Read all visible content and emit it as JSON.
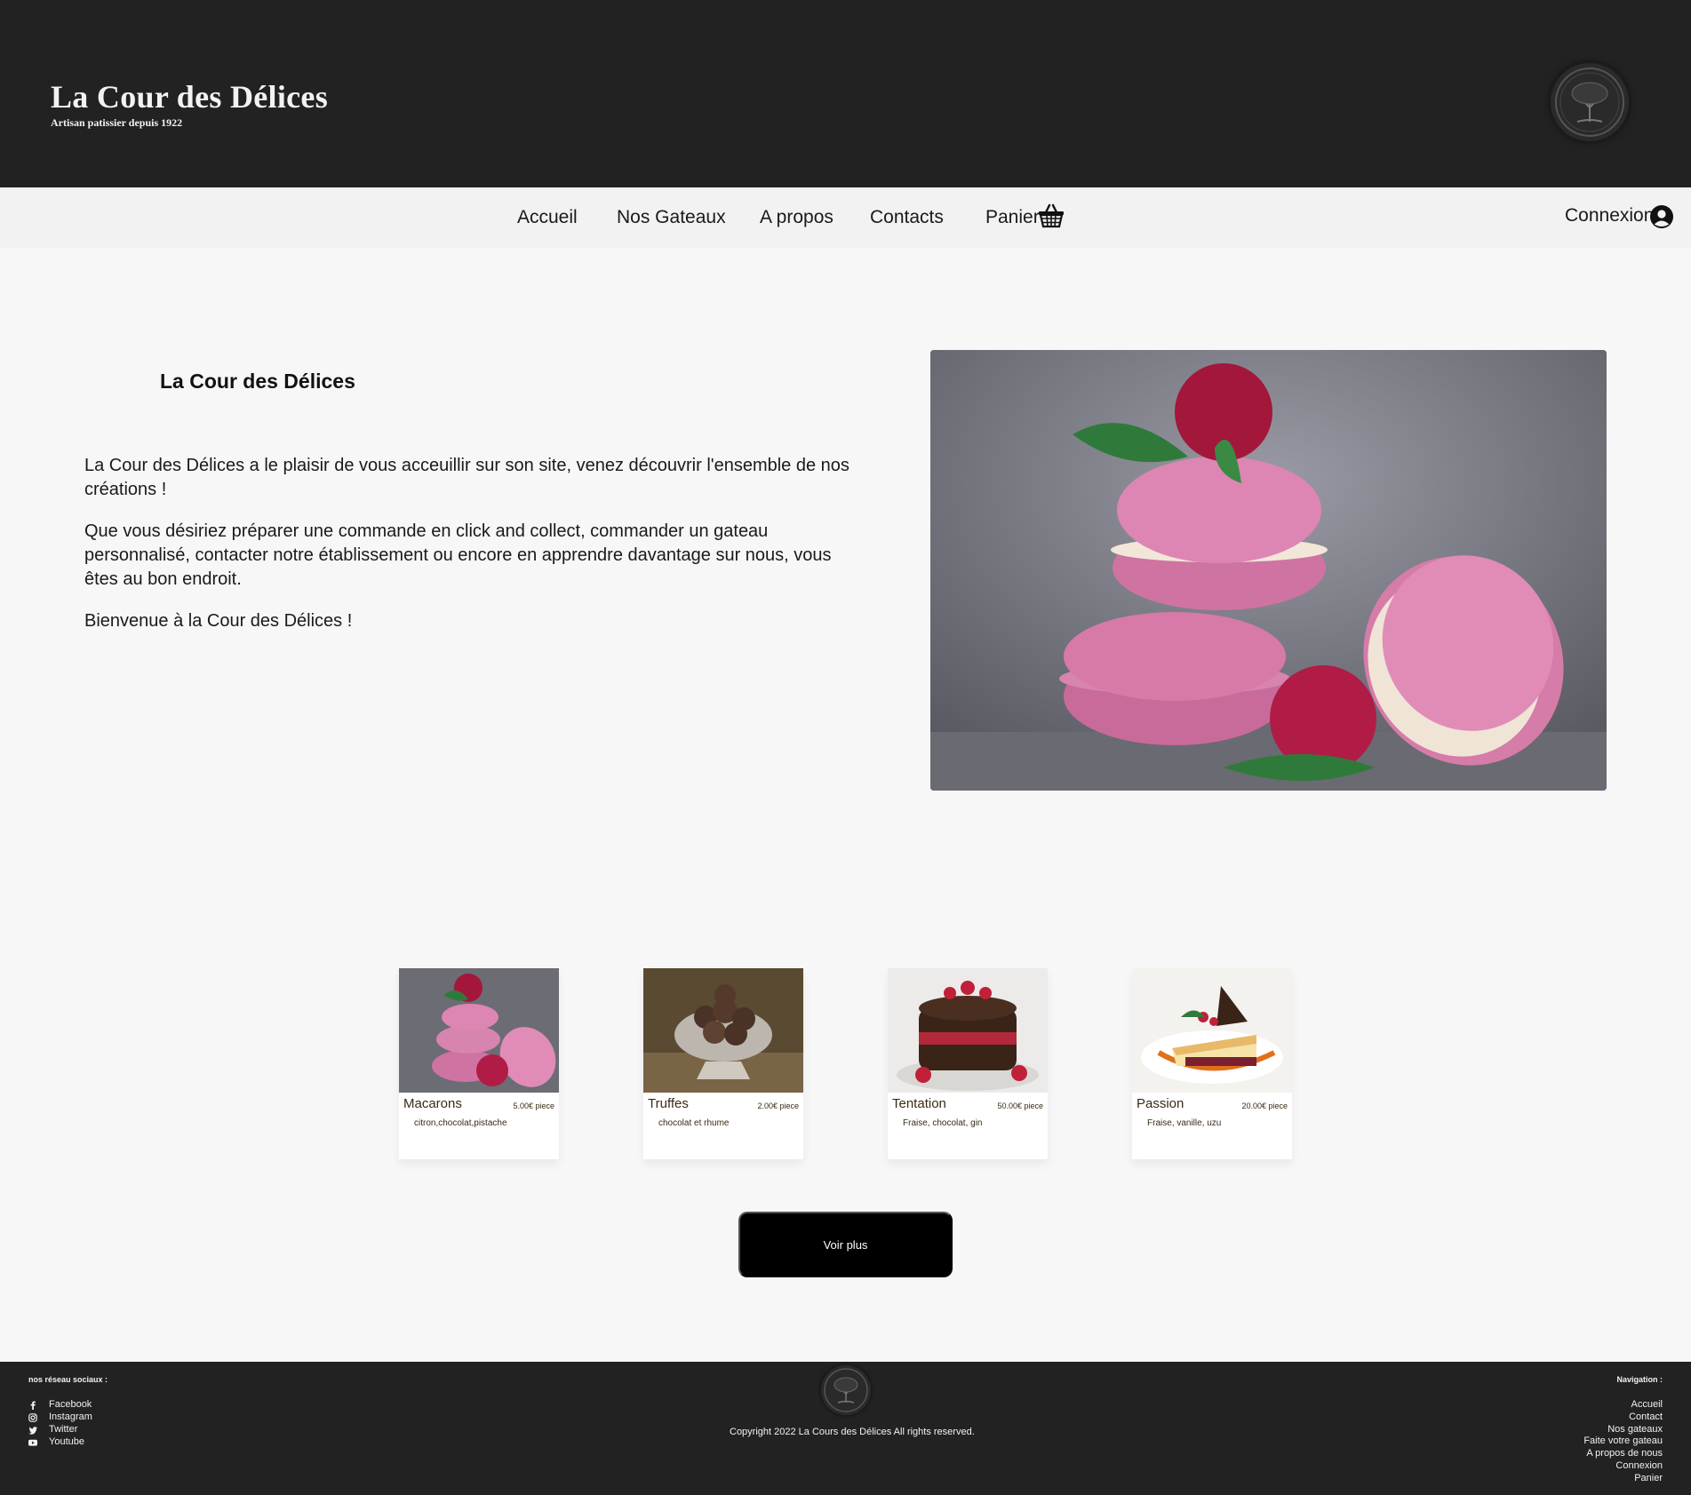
{
  "header": {
    "title": "La Cour des Délices",
    "tagline": "Artisan patissier depuis 1922"
  },
  "nav": {
    "items": [
      {
        "label": "Accueil"
      },
      {
        "label": "Nos Gateaux"
      },
      {
        "label": "A propos"
      },
      {
        "label": "Contacts"
      },
      {
        "label": "Panier"
      }
    ],
    "login_label": "Connexion"
  },
  "hero": {
    "title": "La Cour des Délices",
    "paragraphs": [
      "La Cour des Délices a le plaisir de vous acceuillir sur son site, venez découvrir l'ensemble de nos créations !",
      "Que vous désiriez préparer une commande en click and collect, commander un gateau personnalisé, contacter notre établissement ou encore en apprendre davantage sur nous, vous êtes au bon endroit.",
      "Bienvenue à la Cour des Délices !"
    ]
  },
  "products": [
    {
      "name": "Macarons",
      "price": "5.00€ piece",
      "description": "citron,chocolat,pistache"
    },
    {
      "name": "Truffes",
      "price": "2.00€ piece",
      "description": "chocolat et rhume"
    },
    {
      "name": "Tentation",
      "price": "50.00€ piece",
      "description": "Fraise, chocolat, gin"
    },
    {
      "name": "Passion",
      "price": "20.00€ piece",
      "description": "Fraise, vanille, uzu"
    }
  ],
  "more_button_label": "Voir plus",
  "footer": {
    "social_title": "nos réseau sociaux :",
    "social": [
      {
        "label": "Facebook",
        "icon": "facebook-icon"
      },
      {
        "label": "Instagram",
        "icon": "instagram-icon"
      },
      {
        "label": "Twitter",
        "icon": "twitter-icon"
      },
      {
        "label": "Youtube",
        "icon": "youtube-icon"
      }
    ],
    "copyright": "Copyright 2022 La Cours des Délices All rights reserved.",
    "nav_title": "Navigation :",
    "nav_items": [
      {
        "label": "Accueil"
      },
      {
        "label": "Contact"
      },
      {
        "label": "Nos gateaux"
      },
      {
        "label": "Faite votre gateau"
      },
      {
        "label": "A propos de nous"
      },
      {
        "label": "Connexion"
      },
      {
        "label": "Panier"
      }
    ]
  },
  "colors": {
    "header_bg": "#222222",
    "nav_bg": "#f1f2f1",
    "page_bg": "#f7f7f7",
    "button_bg": "#000000",
    "card_text": "#3a2a14"
  }
}
